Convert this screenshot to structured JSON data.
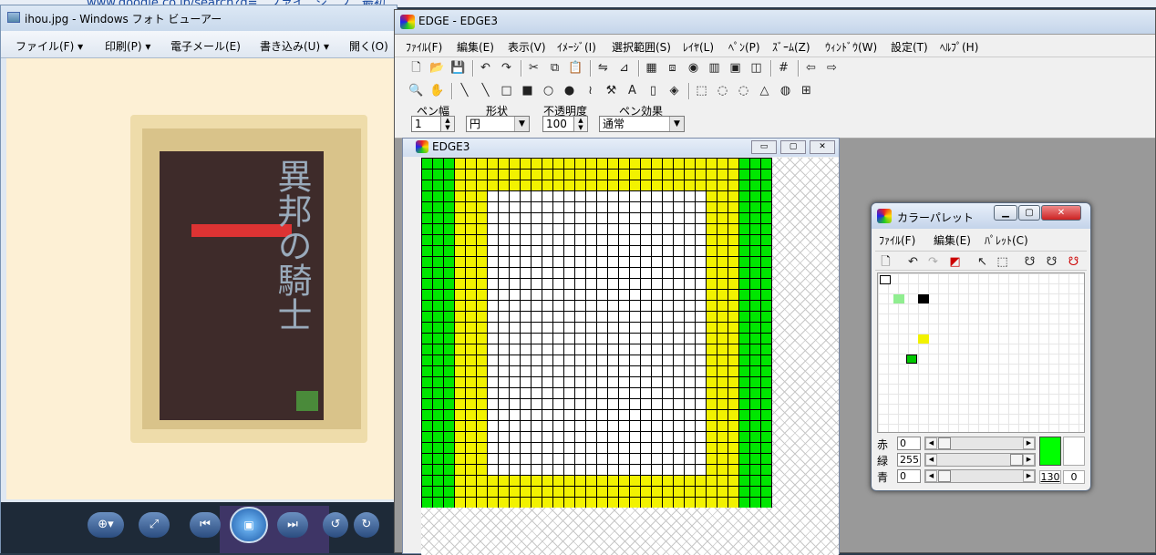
{
  "background": {
    "url_fragment": "www.google.co.jp/search?q=...ファイ...ジ...フ...最初..."
  },
  "photo_viewer": {
    "title": "ihou.jpg - Windows フォト ビューアー",
    "menu": [
      "ファイル(F) ▾",
      "印刷(P) ▾",
      "電子メール(E)",
      "書き込み(U) ▾",
      "開く(O)"
    ],
    "cover_title": "異邦の騎士",
    "controls": [
      "⊕▾",
      "⤢",
      "⏮",
      "▣",
      "⏭",
      "↺",
      "↻"
    ]
  },
  "edge": {
    "title": "EDGE - EDGE3",
    "menu": [
      "ﾌｧｲﾙ(F)",
      "編集(E)",
      "表示(V)",
      "ｲﾒｰｼﾞ(I)",
      "選択範囲(S)",
      "ﾚｲﾔ(L)",
      "ﾍﾟﾝ(P)",
      "ｽﾞｰﾑ(Z)",
      "ｳｨﾝﾄﾞｳ(W)",
      "設定(T)",
      "ﾍﾙﾌﾟ(H)"
    ],
    "toolbar1": [
      {
        "name": "new-icon",
        "glyph": "🗋"
      },
      {
        "name": "open-icon",
        "glyph": "📂"
      },
      {
        "name": "save-icon",
        "glyph": "💾"
      },
      {
        "name": "undo-icon",
        "glyph": "↶"
      },
      {
        "name": "redo-icon",
        "glyph": "↷"
      },
      {
        "name": "cut-icon",
        "glyph": "✂"
      },
      {
        "name": "copy-icon",
        "glyph": "⧉"
      },
      {
        "name": "paste-icon",
        "glyph": "📋"
      },
      {
        "name": "flip-icon",
        "glyph": "⇋"
      },
      {
        "name": "mirror-icon",
        "glyph": "⊿"
      },
      {
        "name": "grid-icon",
        "glyph": "▦"
      },
      {
        "name": "layer-icon",
        "glyph": "⧈"
      },
      {
        "name": "palette-icon",
        "glyph": "◉"
      },
      {
        "name": "film-icon",
        "glyph": "▥"
      },
      {
        "name": "image-icon",
        "glyph": "▣"
      },
      {
        "name": "preview-icon",
        "glyph": "◫"
      },
      {
        "name": "pixel-grid-icon",
        "glyph": "#"
      },
      {
        "name": "arrow-left-icon",
        "glyph": "⇦"
      },
      {
        "name": "arrow-right-icon",
        "glyph": "⇨"
      }
    ],
    "toolbar2": [
      {
        "name": "zoom-icon",
        "glyph": "🔍"
      },
      {
        "name": "hand-icon",
        "glyph": "✋"
      },
      {
        "name": "pen-icon",
        "glyph": "╲"
      },
      {
        "name": "line-icon",
        "glyph": "╲"
      },
      {
        "name": "rect-icon",
        "glyph": "□"
      },
      {
        "name": "rect-fill-icon",
        "glyph": "■"
      },
      {
        "name": "ellipse-icon",
        "glyph": "○"
      },
      {
        "name": "ellipse-fill-icon",
        "glyph": "●"
      },
      {
        "name": "curve-icon",
        "glyph": "≀"
      },
      {
        "name": "fill-icon",
        "glyph": "⚒"
      },
      {
        "name": "text-icon",
        "glyph": "A"
      },
      {
        "name": "eraser-icon",
        "glyph": "▯"
      },
      {
        "name": "bucket-icon",
        "glyph": "◈"
      },
      {
        "name": "select-rect-icon",
        "glyph": "⬚"
      },
      {
        "name": "select-ellipse-icon",
        "glyph": "◌"
      },
      {
        "name": "select-lasso-icon",
        "glyph": "◌"
      },
      {
        "name": "select-poly-icon",
        "glyph": "△"
      },
      {
        "name": "magic-wand-icon",
        "glyph": "◍"
      },
      {
        "name": "select-color-icon",
        "glyph": "⊞"
      }
    ],
    "pen_bar": {
      "width_label": "ペン幅",
      "width_value": "1",
      "shape_label": "形状",
      "shape_value": "円",
      "opacity_label": "不透明度",
      "opacity_value": "100",
      "effect_label": "ペン効果",
      "effect_value": "通常"
    },
    "child": {
      "title": "EDGE3",
      "min": "▭",
      "max": "▢",
      "close": "✕"
    },
    "image": {
      "grid_cells": 32,
      "colors": {
        "green": "#00e600",
        "yellow": "#f2f200",
        "white": "#ffffff"
      },
      "outer_green_cols": 3,
      "yellow_band": 3
    }
  },
  "palette": {
    "title": "カラーパレット",
    "menu": [
      "ﾌｧｲﾙ(F)",
      "編集(E)",
      "ﾊﾟﾚｯﾄ(C)"
    ],
    "tools": [
      "🗋",
      "↶",
      "↷",
      "◩",
      "↖",
      "⬚",
      "☋",
      "☋",
      "☋"
    ],
    "swatches": [
      {
        "color": "#ffffff"
      },
      {
        "color": "#90ee90"
      },
      {
        "color": "#000000"
      },
      {
        "color": "#f2f200"
      },
      {
        "color": "#00c800"
      }
    ],
    "labels": {
      "r": "赤",
      "g": "緑",
      "b": "青"
    },
    "values": {
      "r": "0",
      "g": "255",
      "b": "0"
    },
    "fore_color": "#00ff00",
    "back_color": "#ffffff",
    "index": "130",
    "alpha": "0"
  }
}
